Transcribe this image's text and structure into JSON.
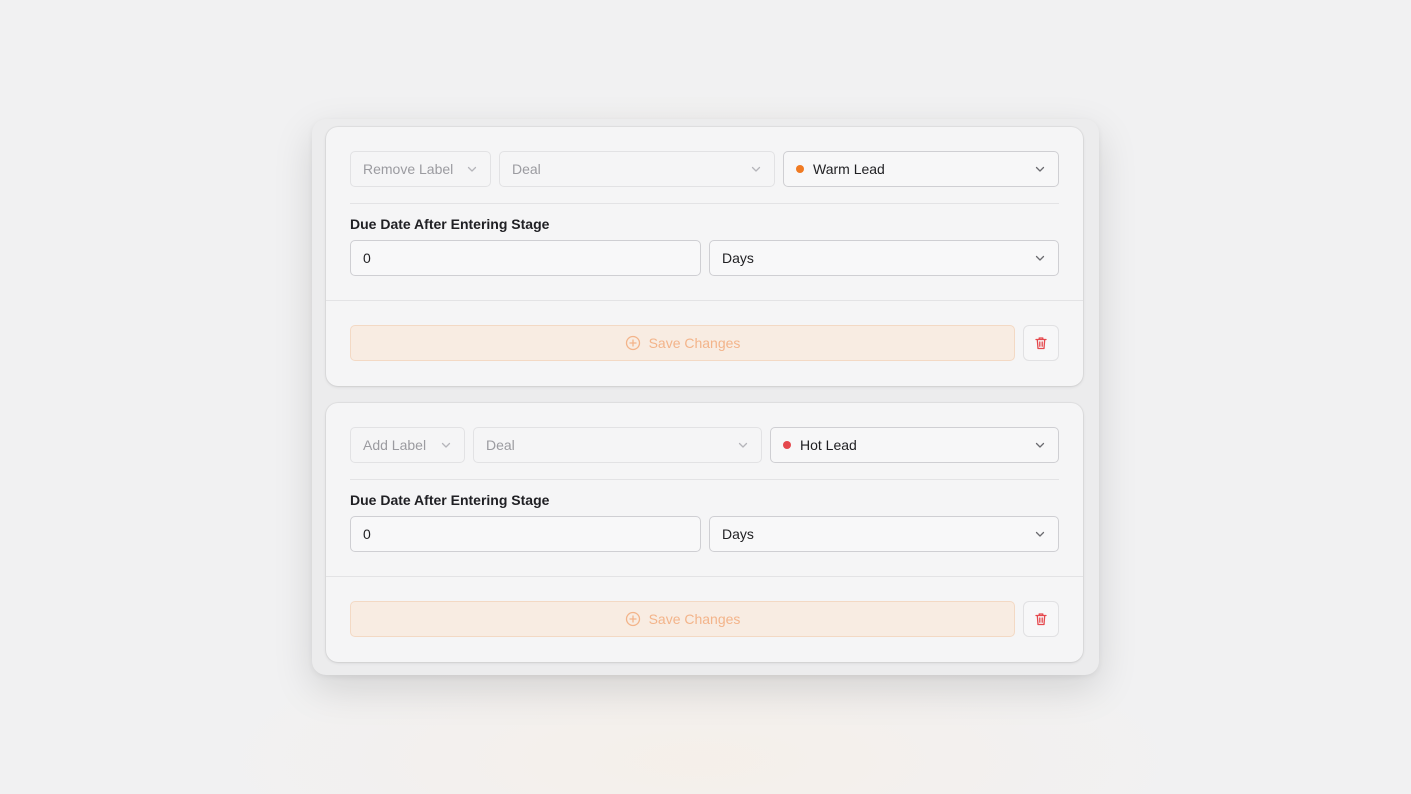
{
  "colors": {
    "warm": "#f07a22",
    "hot": "#e5484d",
    "accent_text": "#f3b48a",
    "danger": "#e5484d"
  },
  "cards": [
    {
      "action": "Remove Label",
      "entity": "Deal",
      "stage": "Warm Lead",
      "due_label": "Due Date After Entering Stage",
      "due_value": "0",
      "unit": "Days",
      "save_label": "Save Changes"
    },
    {
      "action": "Add Label",
      "entity": "Deal",
      "stage": "Hot Lead",
      "due_label": "Due Date After Entering Stage",
      "due_value": "0",
      "unit": "Days",
      "save_label": "Save Changes"
    }
  ],
  "icons": {
    "chevron": "chevron-down-icon",
    "save": "plus-circle-icon",
    "delete": "trash-icon"
  }
}
